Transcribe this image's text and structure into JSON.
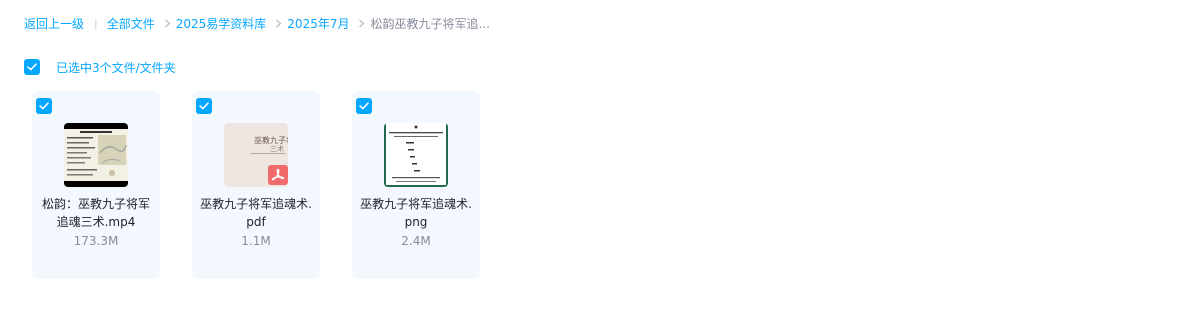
{
  "breadcrumb": {
    "back": "返回上一级",
    "items": [
      "全部文件",
      "2025易学资料库",
      "2025年7月"
    ],
    "current": "松韵巫教九子将军追..."
  },
  "selection": {
    "text": "已选中3个文件/文件夹"
  },
  "files": [
    {
      "name": "松韵：巫教九子将军追魂三术.mp4",
      "size": "173.3M",
      "type": "video",
      "selected": true
    },
    {
      "name": "巫教九子将军追魂术.pdf",
      "size": "1.1M",
      "type": "pdf",
      "selected": true,
      "thumb_text": [
        "巫教九子将軍",
        "三术"
      ]
    },
    {
      "name": "巫教九子将军追魂术.png",
      "size": "2.4M",
      "type": "image",
      "selected": true
    }
  ],
  "colors": {
    "accent": "#06a7ff",
    "card_bg": "#f2f8fe",
    "muted_text": "#878c9c",
    "pdf_badge": "#f26b6b"
  }
}
